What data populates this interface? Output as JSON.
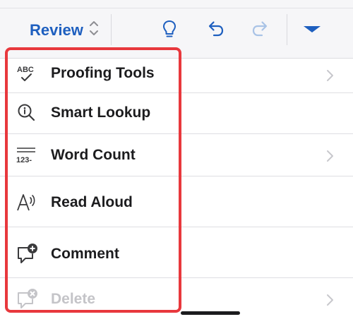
{
  "toolbar": {
    "tab_label": "Review",
    "icons": [
      "sort-updown-icon",
      "lightbulb-icon",
      "undo-icon",
      "redo-icon",
      "dropdown-triangle-icon"
    ],
    "accent_color": "#1e5fbf"
  },
  "menu": {
    "items": [
      {
        "label": "Proofing Tools",
        "icon": "abc-check-icon",
        "has_submenu": true,
        "enabled": true
      },
      {
        "label": "Smart Lookup",
        "icon": "search-info-icon",
        "has_submenu": false,
        "enabled": true
      },
      {
        "label": "Word Count",
        "icon": "word-count-icon",
        "has_submenu": true,
        "enabled": true
      },
      {
        "label": "Read Aloud",
        "icon": "read-aloud-icon",
        "has_submenu": false,
        "enabled": true
      },
      {
        "label": "Comment",
        "icon": "new-comment-icon",
        "has_submenu": false,
        "enabled": true
      },
      {
        "label": "Delete",
        "icon": "delete-comment-icon",
        "has_submenu": true,
        "enabled": false
      }
    ]
  },
  "highlight_color": "#e8383d"
}
